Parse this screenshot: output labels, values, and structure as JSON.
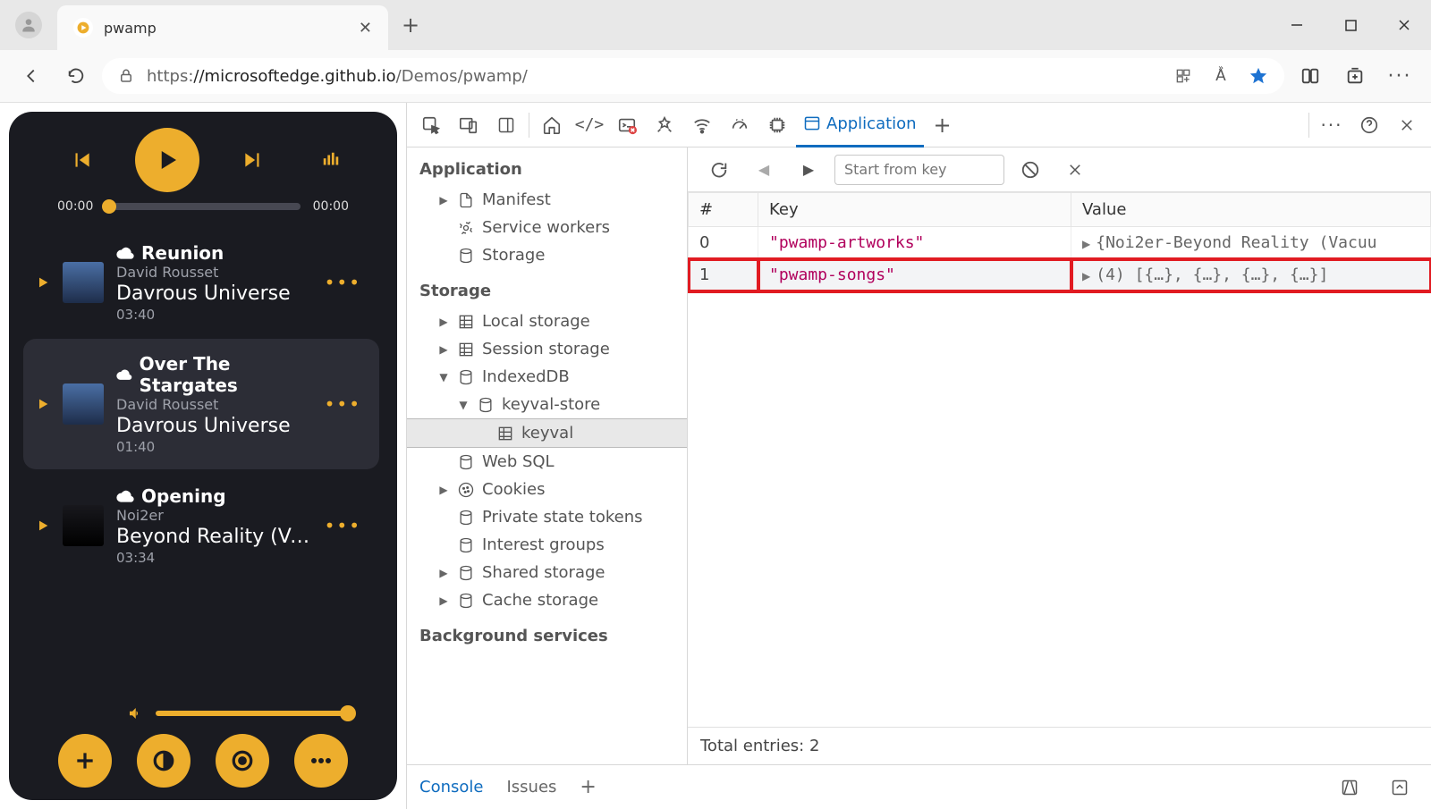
{
  "browser": {
    "tab_title": "pwamp",
    "url_prefix": "https:",
    "url_host": "//microsoftedge.github.io",
    "url_path": "/Demos/pwamp/"
  },
  "player": {
    "time_current": "00:00",
    "time_total": "00:00",
    "tracks": [
      {
        "title": "Reunion",
        "artist": "David Rousset",
        "album": "Davrous Universe",
        "duration": "03:40",
        "active": false
      },
      {
        "title": "Over The Stargates",
        "artist": "David Rousset",
        "album": "Davrous Universe",
        "duration": "01:40",
        "active": true
      },
      {
        "title": "Opening",
        "artist": "Noi2er",
        "album": "Beyond Reality (Vac...",
        "duration": "03:34",
        "active": false
      }
    ]
  },
  "devtools": {
    "active_tab": "Application",
    "sidebar": {
      "section_app": "Application",
      "items_app": [
        "Manifest",
        "Service workers",
        "Storage"
      ],
      "section_storage": "Storage",
      "items_storage": {
        "local": "Local storage",
        "session": "Session storage",
        "indexeddb": "IndexedDB",
        "keyval_store": "keyval-store",
        "keyval": "keyval",
        "websql": "Web SQL",
        "cookies": "Cookies",
        "pst": "Private state tokens",
        "ig": "Interest groups",
        "shared": "Shared storage",
        "cache": "Cache storage"
      },
      "section_bg": "Background services"
    },
    "toolbar": {
      "filter_placeholder": "Start from key"
    },
    "table": {
      "col_idx": "#",
      "col_key": "Key",
      "col_val": "Value",
      "rows": [
        {
          "idx": "0",
          "key": "\"pwamp-artworks\"",
          "value": "{Noi2er-Beyond Reality (Vacuu",
          "highlight": false
        },
        {
          "idx": "1",
          "key": "\"pwamp-songs\"",
          "value": "(4) [{…}, {…}, {…}, {…}]",
          "highlight": true
        }
      ],
      "status": "Total entries: 2"
    },
    "drawer": {
      "console": "Console",
      "issues": "Issues"
    }
  }
}
